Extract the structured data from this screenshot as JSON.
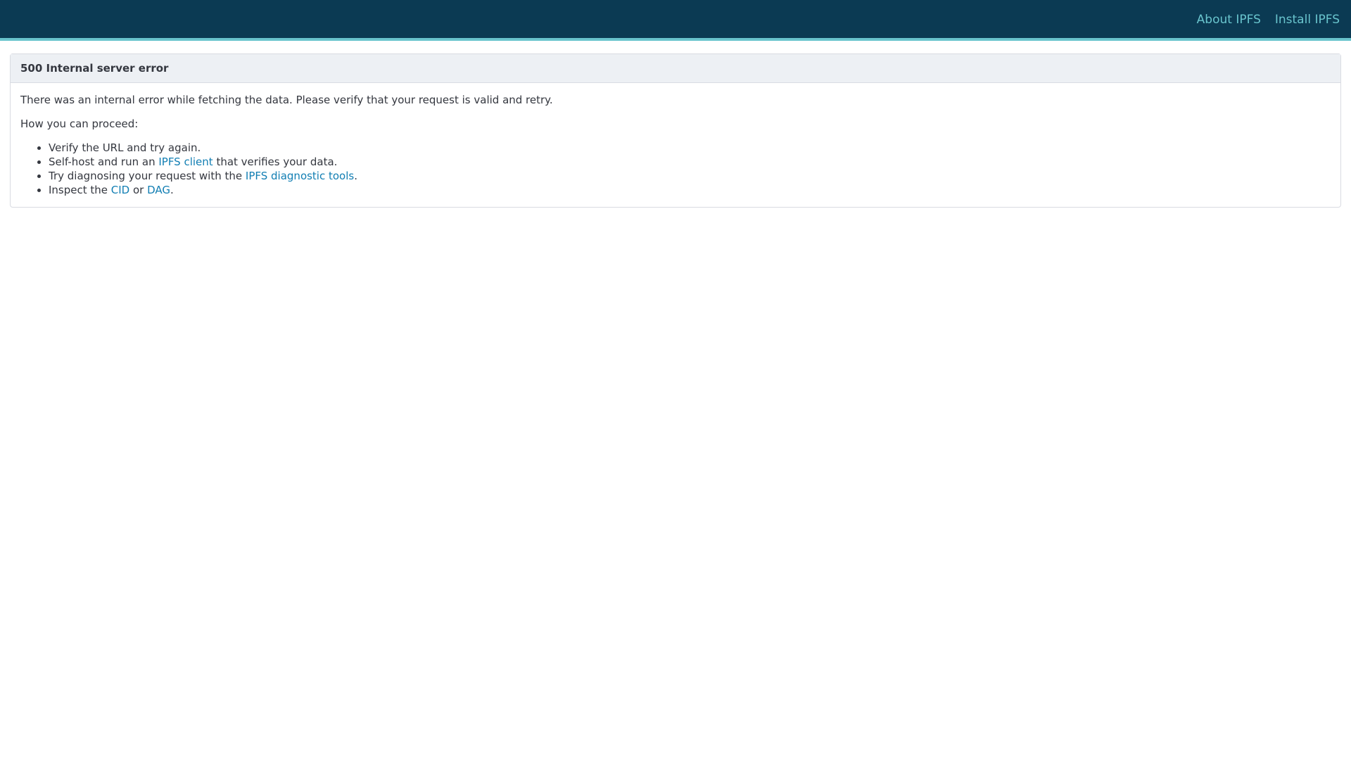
{
  "header": {
    "nav": {
      "about": "About IPFS",
      "install": "Install IPFS"
    }
  },
  "error": {
    "title": "500 Internal server error",
    "description": "There was an internal error while fetching the data. Please verify that your request is valid and retry.",
    "proceed_label": "How you can proceed:",
    "steps": [
      {
        "text": "Verify the URL and try again."
      },
      {
        "pre": "Self-host and run an ",
        "link": "IPFS client",
        "post": " that verifies your data."
      },
      {
        "pre": "Try diagnosing your request with the ",
        "link": "IPFS diagnostic tools",
        "post": "."
      },
      {
        "pre": "Inspect the ",
        "link1": "CID",
        "mid": " or ",
        "link2": "DAG",
        "post": "."
      }
    ]
  },
  "colors": {
    "header_bg": "#0b3a53",
    "header_accent": "#69c4cd",
    "link": "#117eb3",
    "card_header_bg": "#edf0f4"
  }
}
